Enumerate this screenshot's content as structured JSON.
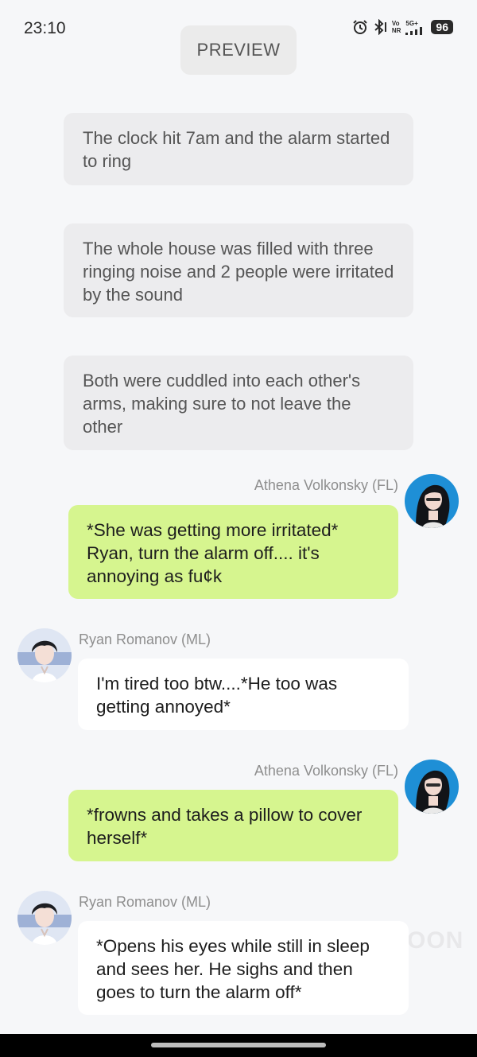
{
  "status_bar": {
    "time": "23:10",
    "network_top": "Vo",
    "network_bottom": "NR",
    "signal_label": "5G+",
    "battery": "96"
  },
  "preview_label": "PREVIEW",
  "narrations": [
    "The clock hit 7am and the alarm started to ring",
    "The whole house was filled with three ringing noise and 2 people were irritated by the sound",
    "Both were cuddled into each other's arms, making sure to not leave the other"
  ],
  "messages": [
    {
      "sender": "Athena Volkonsky (FL)",
      "text": "*She was getting more irritated* Ryan, turn the alarm off.... it's annoying as fu¢k"
    },
    {
      "sender": "Ryan Romanov (ML)",
      "text": "I'm tired too btw....*He too was getting annoyed*"
    },
    {
      "sender": "Athena Volkonsky (FL)",
      "text": "*frowns and takes a pillow to cover herself*"
    },
    {
      "sender": "Ryan Romanov (ML)",
      "text": "*Opens his eyes while still in sleep and sees her. He sighs and then goes to turn the alarm off*"
    }
  ],
  "watermark": "OON",
  "colors": {
    "user_bubble": "#d6f58f",
    "bot_bubble": "#ffffff",
    "narration_bubble": "#ececee",
    "background": "#f6f7f9"
  },
  "icons": {
    "alarm": "alarm-icon",
    "bluetooth": "bluetooth-icon",
    "signal": "signal-icon"
  }
}
